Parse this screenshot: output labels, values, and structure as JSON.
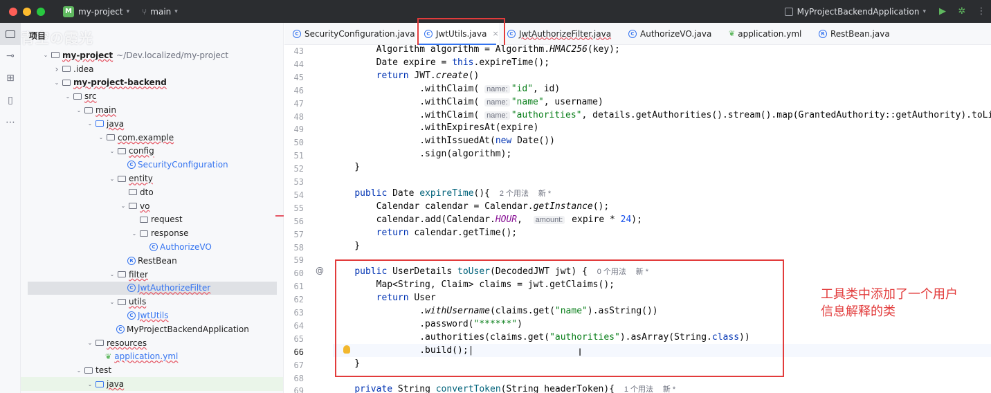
{
  "titlebar": {
    "project_badge": "M",
    "project_name": "my-project",
    "branch": "main",
    "run_config": "MyProjectBackendApplication",
    "colors": {
      "close": "#ff5f57",
      "minimize": "#febc2e",
      "maximize": "#28c840",
      "run": "#5fb85f"
    },
    "icons": [
      "branch-icon",
      "run-icon",
      "debug-icon",
      "more-icon"
    ]
  },
  "toolstrip": {
    "icons": [
      "folder-icon",
      "commit-icon",
      "structure-icon",
      "bookmarks-icon",
      "more-tools-icon"
    ]
  },
  "project_panel": {
    "title": "项目",
    "watermark": "青空の霞光",
    "tree": [
      {
        "label": "my-project",
        "suffix": "~/Dev.localized/my-project",
        "depth": 0,
        "kind": "module",
        "expanded": true
      },
      {
        "label": ".idea",
        "depth": 1,
        "kind": "folder",
        "expanded": false
      },
      {
        "label": "my-project-backend",
        "depth": 1,
        "kind": "module",
        "expanded": true
      },
      {
        "label": "src",
        "depth": 2,
        "kind": "folder",
        "expanded": true
      },
      {
        "label": "main",
        "depth": 3,
        "kind": "folder",
        "expanded": true
      },
      {
        "label": "java",
        "depth": 4,
        "kind": "src",
        "expanded": true
      },
      {
        "label": "com.example",
        "depth": 5,
        "kind": "pkg",
        "expanded": true
      },
      {
        "label": "config",
        "depth": 6,
        "kind": "pkg",
        "expanded": true
      },
      {
        "label": "SecurityConfiguration",
        "depth": 7,
        "kind": "class"
      },
      {
        "label": "entity",
        "depth": 6,
        "kind": "pkg",
        "expanded": true
      },
      {
        "label": "dto",
        "depth": 7,
        "kind": "pkg",
        "expanded": null
      },
      {
        "label": "vo",
        "depth": 7,
        "kind": "pkg",
        "expanded": true
      },
      {
        "label": "request",
        "depth": 8,
        "kind": "pkg",
        "expanded": null
      },
      {
        "label": "response",
        "depth": 8,
        "kind": "pkg",
        "expanded": true
      },
      {
        "label": "AuthorizeVO",
        "depth": 9,
        "kind": "class"
      },
      {
        "label": "RestBean",
        "depth": 7,
        "kind": "record"
      },
      {
        "label": "filter",
        "depth": 6,
        "kind": "pkg",
        "expanded": true
      },
      {
        "label": "JwtAuthorizeFilter",
        "depth": 7,
        "kind": "class",
        "selected": true
      },
      {
        "label": "utils",
        "depth": 6,
        "kind": "pkg",
        "expanded": true
      },
      {
        "label": "JwtUtils",
        "depth": 7,
        "kind": "class"
      },
      {
        "label": "MyProjectBackendApplication",
        "depth": 6,
        "kind": "app"
      },
      {
        "label": "resources",
        "depth": 4,
        "kind": "res",
        "expanded": true
      },
      {
        "label": "application.yml",
        "depth": 5,
        "kind": "yml"
      },
      {
        "label": "test",
        "depth": 3,
        "kind": "folder",
        "expanded": true
      },
      {
        "label": "java",
        "depth": 4,
        "kind": "src",
        "expanded": true
      }
    ]
  },
  "tabs": [
    {
      "label": "SecurityConfiguration.java",
      "kind": "class"
    },
    {
      "label": "JwtUtils.java",
      "kind": "class",
      "active": true,
      "close": "×"
    },
    {
      "label": "JwtAuthorizeFilter.java",
      "kind": "class",
      "underline": true
    },
    {
      "label": "AuthorizeVO.java",
      "kind": "class"
    },
    {
      "label": "application.yml",
      "kind": "yml"
    },
    {
      "label": "RestBean.java",
      "kind": "record"
    }
  ],
  "editor": {
    "line_numbers": [
      43,
      44,
      45,
      46,
      47,
      48,
      49,
      50,
      51,
      52,
      53,
      54,
      55,
      56,
      57,
      58,
      59,
      60,
      61,
      62,
      63,
      64,
      65,
      66,
      67,
      68,
      69
    ],
    "current_line": 66,
    "usages": {
      "expire_time": "2 个用法",
      "to_user": "0 个用法",
      "convert_token": "1 个用法",
      "new_marker": "新 *"
    },
    "hints": {
      "name": "name:",
      "amount": "amount:"
    },
    "annotation": [
      "工具类中添加了一个用户",
      "信息解释的类"
    ]
  }
}
